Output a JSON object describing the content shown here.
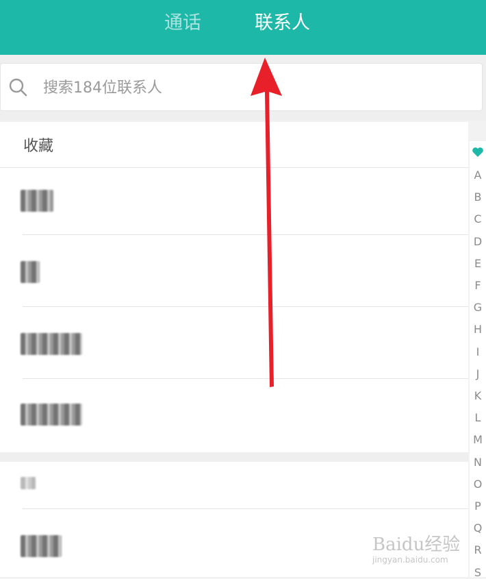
{
  "tabs": {
    "calls": "通话",
    "contacts": "联系人"
  },
  "search": {
    "placeholder": "搜索184位联系人"
  },
  "favorites": {
    "title": "收藏",
    "contacts": [
      {
        "name": "▪▪▪"
      },
      {
        "name": "▪"
      },
      {
        "name": "▪▪▪▪"
      },
      {
        "name": "▪▪▪"
      }
    ]
  },
  "contacts": [
    {
      "name": "▪"
    },
    {
      "name": "▪▪"
    }
  ],
  "index": [
    "A",
    "B",
    "C",
    "D",
    "E",
    "F",
    "G",
    "H",
    "I",
    "J",
    "K",
    "L",
    "M",
    "N",
    "O",
    "P",
    "Q",
    "R",
    "S"
  ],
  "colors": {
    "accent": "#1db8a8",
    "arrow": "#e8202a"
  },
  "watermark": {
    "brand": "Baidu经验",
    "url": "jingyan.baidu.com"
  }
}
